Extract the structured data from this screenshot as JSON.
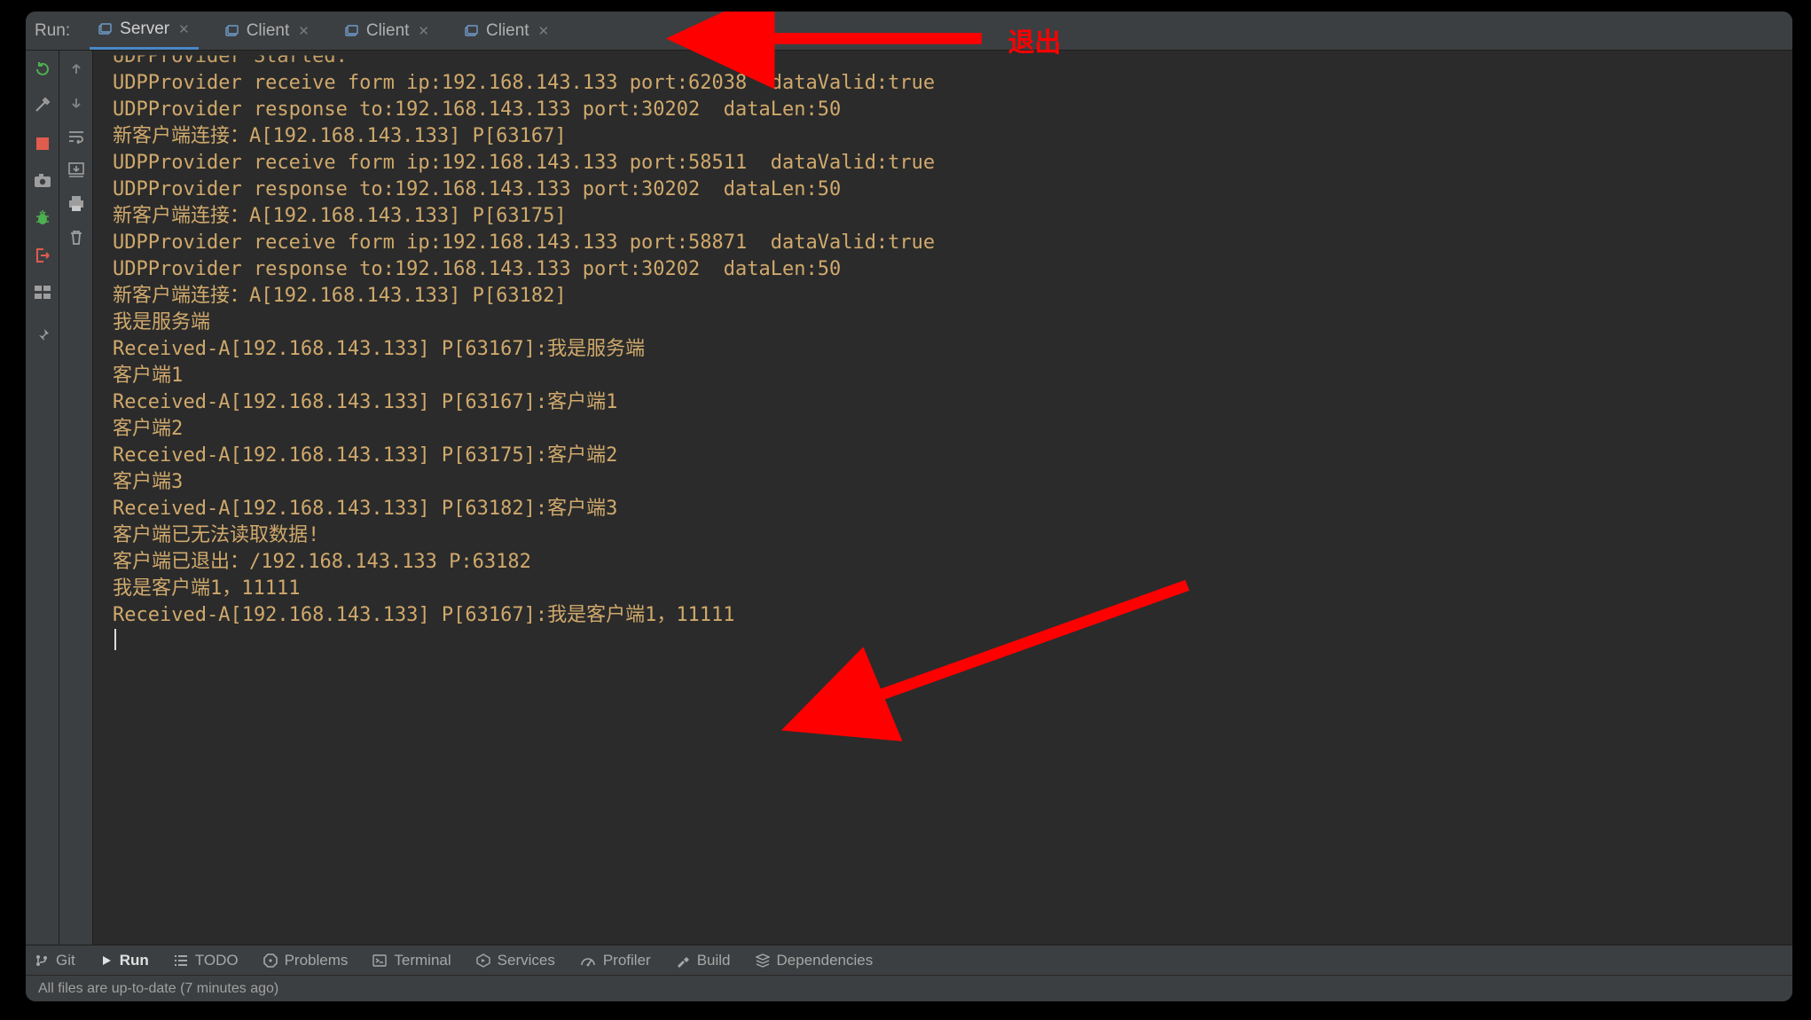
{
  "tabstrip": {
    "run_label": "Run:",
    "tabs": [
      {
        "label": "Server",
        "active": true
      },
      {
        "label": "Client",
        "active": false
      },
      {
        "label": "Client",
        "active": false
      },
      {
        "label": "Client",
        "active": false
      }
    ],
    "annotation_top": "退出"
  },
  "left_icons": {
    "rerun": "rerun-icon",
    "settings": "settings-icon",
    "stop": "stop-icon",
    "camera": "camera-icon",
    "bug": "bug-icon",
    "exit": "exit-icon",
    "layout": "layout-icon",
    "pin": "pin-icon"
  },
  "left2_icons": {
    "up": "up-arrow-icon",
    "down": "down-arrow-icon",
    "wrap": "wrap-icon",
    "scroll": "scroll-to-end-icon",
    "print": "print-icon",
    "trash": "trash-icon"
  },
  "console_lines": [
    "UDPProvider Started.",
    "UDPProvider receive form ip:192.168.143.133 port:62038  dataValid:true",
    "UDPProvider response to:192.168.143.133 port:30202  dataLen:50",
    "新客户端连接：A[192.168.143.133] P[63167]",
    "UDPProvider receive form ip:192.168.143.133 port:58511  dataValid:true",
    "UDPProvider response to:192.168.143.133 port:30202  dataLen:50",
    "新客户端连接：A[192.168.143.133] P[63175]",
    "UDPProvider receive form ip:192.168.143.133 port:58871  dataValid:true",
    "UDPProvider response to:192.168.143.133 port:30202  dataLen:50",
    "新客户端连接：A[192.168.143.133] P[63182]",
    "我是服务端",
    "Received-A[192.168.143.133] P[63167]:我是服务端",
    "客户端1",
    "Received-A[192.168.143.133] P[63167]:客户端1",
    "客户端2",
    "Received-A[192.168.143.133] P[63175]:客户端2",
    "客户端3",
    "Received-A[192.168.143.133] P[63182]:客户端3",
    "客户端已无法读取数据!",
    "客户端已退出：/192.168.143.133 P:63182",
    "我是客户端1，11111",
    "Received-A[192.168.143.133] P[63167]:我是客户端1，11111"
  ],
  "tooltabs": [
    {
      "label": "Git",
      "icon": "branch-icon"
    },
    {
      "label": "Run",
      "icon": "play-icon",
      "active": true
    },
    {
      "label": "TODO",
      "icon": "list-icon"
    },
    {
      "label": "Problems",
      "icon": "stop-sign-icon"
    },
    {
      "label": "Terminal",
      "icon": "terminal-icon"
    },
    {
      "label": "Services",
      "icon": "services-icon"
    },
    {
      "label": "Profiler",
      "icon": "gauge-icon"
    },
    {
      "label": "Build",
      "icon": "hammer-icon"
    },
    {
      "label": "Dependencies",
      "icon": "layers-icon"
    }
  ],
  "status_text": "All files are up-to-date (7 minutes ago)",
  "colors": {
    "console_fg": "#d0a96c",
    "tab_underline": "#4a88c7",
    "annotation_red": "#ff0000",
    "stop_red": "#e05c4e",
    "rerun_green": "#4caf50"
  }
}
